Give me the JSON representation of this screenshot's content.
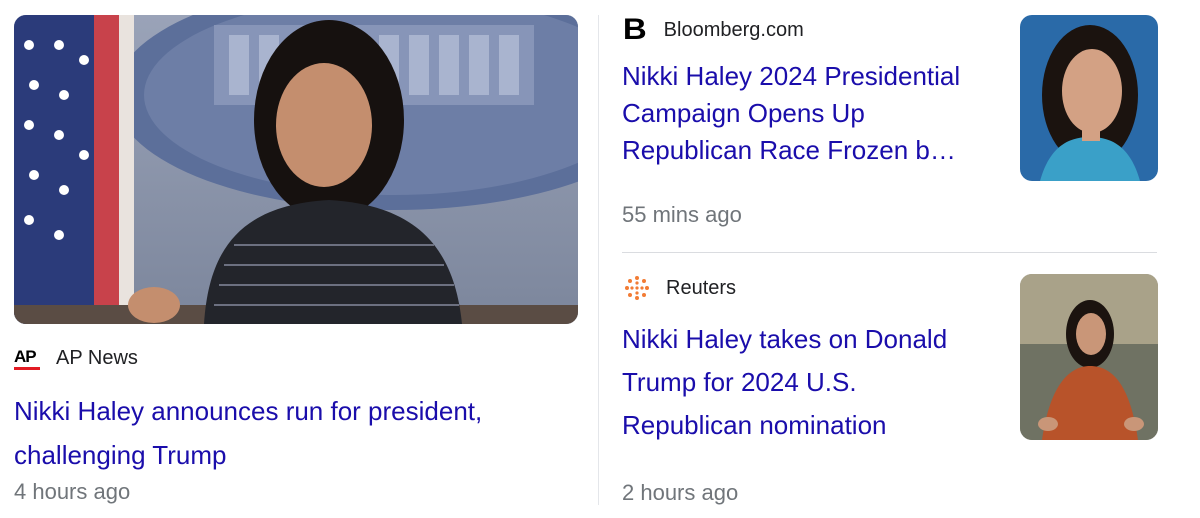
{
  "stories": [
    {
      "source": "AP News",
      "source_logo_text": "AP",
      "headline_line1": "Nikki Haley announces run for president,",
      "headline_line2": "challenging Trump",
      "time": "4 hours ago",
      "image_icon": "photo-podium-speaker"
    },
    {
      "source": "Bloomberg.com",
      "source_logo_text": "B",
      "headline_line1": "Nikki Haley 2024 Presidential",
      "headline_line2": "Campaign Opens Up",
      "headline_line3": "Republican Race Frozen b…",
      "time": "55 mins ago",
      "image_icon": "photo-portrait"
    },
    {
      "source": "Reuters",
      "headline_line1": "Nikki Haley takes on Donald",
      "headline_line2": "Trump for 2024 U.S.",
      "headline_line3": "Republican nomination",
      "time": "2 hours ago",
      "image_icon": "photo-outdoor-jacket"
    }
  ],
  "colors": {
    "headline": "#1a0dab",
    "timestamp": "#70757a",
    "source": "#202124",
    "ap_red": "#e21b23",
    "reuters_orange": "#f27c35"
  }
}
